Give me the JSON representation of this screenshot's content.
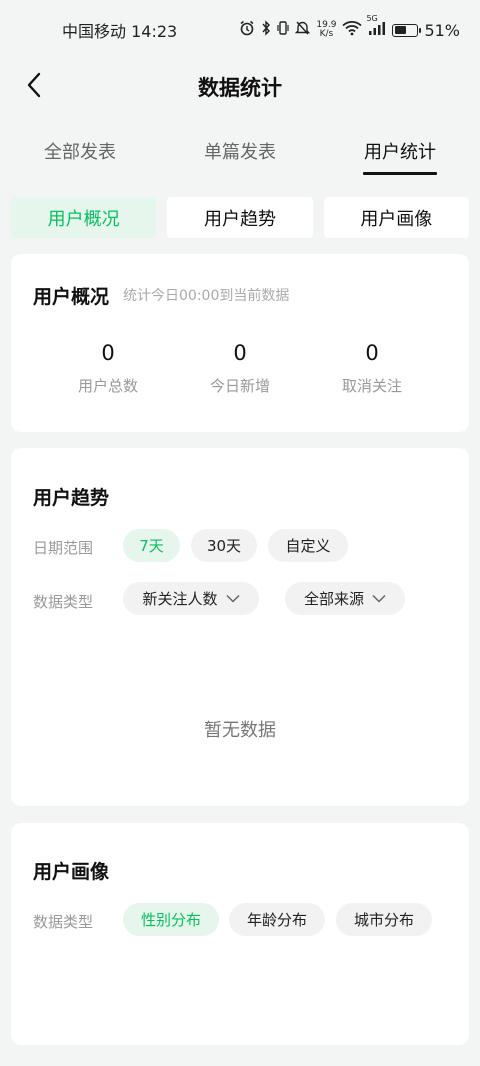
{
  "status_bar": {
    "carrier_time": "中国移动 14:23",
    "net_speed_value": "19.9",
    "net_speed_unit": "K/s",
    "signal_label": "5G",
    "battery_percent": "51%",
    "battery_level": 0.51,
    "icons": [
      "alarm-icon",
      "bluetooth-icon",
      "vibrate-icon",
      "mute-icon",
      "wifi-icon",
      "signal-icon",
      "battery-icon"
    ]
  },
  "nav": {
    "title": "数据统计",
    "back_icon": "chevron-left-icon"
  },
  "top_tabs": [
    {
      "label": "全部发表",
      "active": false
    },
    {
      "label": "单篇发表",
      "active": false
    },
    {
      "label": "用户统计",
      "active": true
    }
  ],
  "segments": [
    {
      "label": "用户概况",
      "active": true
    },
    {
      "label": "用户趋势",
      "active": false
    },
    {
      "label": "用户画像",
      "active": false
    }
  ],
  "overview": {
    "title": "用户概况",
    "subtitle": "统计今日00:00到当前数据",
    "stats": [
      {
        "value": "0",
        "label": "用户总数"
      },
      {
        "value": "0",
        "label": "今日新增"
      },
      {
        "value": "0",
        "label": "取消关注"
      }
    ]
  },
  "trend": {
    "title": "用户趋势",
    "date_range_label": "日期范围",
    "date_options": [
      {
        "label": "7天",
        "active": true
      },
      {
        "label": "30天",
        "active": false
      },
      {
        "label": "自定义",
        "active": false
      }
    ],
    "data_type_label": "数据类型",
    "type_dropdown": "新关注人数",
    "source_dropdown": "全部来源",
    "empty_text": "暂无数据"
  },
  "portrait": {
    "title": "用户画像",
    "data_type_label": "数据类型",
    "options": [
      {
        "label": "性别分布",
        "active": true
      },
      {
        "label": "年龄分布",
        "active": false
      },
      {
        "label": "城市分布",
        "active": false
      }
    ]
  },
  "colors": {
    "accent": "#07c160",
    "accent_bg": "#e6f6ec",
    "page_bg": "#f3f5f4",
    "card_bg": "#ffffff",
    "pill_bg": "#f2f2f2"
  }
}
